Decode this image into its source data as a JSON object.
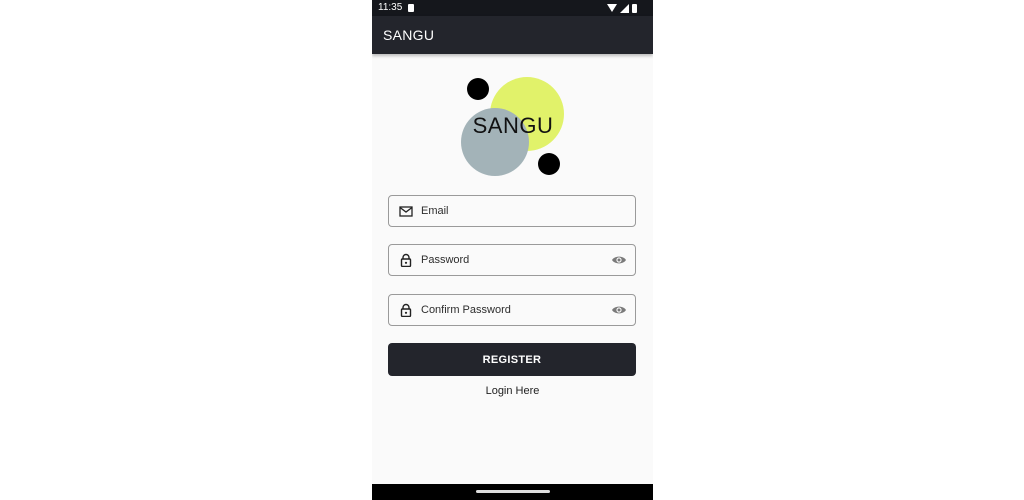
{
  "status_bar": {
    "time": "11:35"
  },
  "app_bar": {
    "title": "SANGU"
  },
  "logo": {
    "text": "SANGU",
    "colors": {
      "accent": "#e1f26a",
      "secondary": "#a3b3b8",
      "dots": "#000000"
    }
  },
  "form": {
    "email": {
      "placeholder": "Email",
      "value": "",
      "icon": "mail-icon"
    },
    "password": {
      "placeholder": "Password",
      "value": "",
      "icon": "lock-icon",
      "toggle_icon": "eye-icon"
    },
    "confirm_password": {
      "placeholder": "Confirm Password",
      "value": "",
      "icon": "lock-icon",
      "toggle_icon": "eye-icon"
    },
    "register_label": "REGISTER",
    "login_link": "Login Here"
  },
  "theme": {
    "primary": "#23252c",
    "background": "#fafafa"
  }
}
